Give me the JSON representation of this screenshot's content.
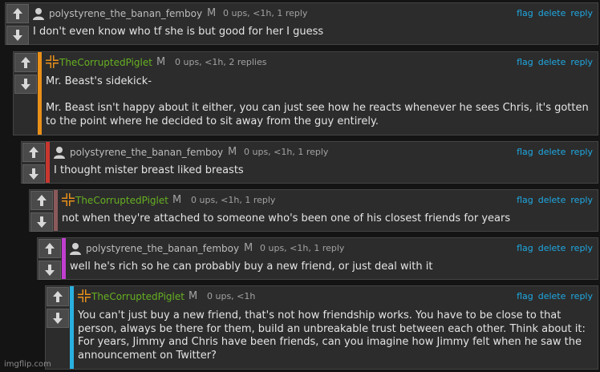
{
  "comments": [
    {
      "username": "polystyrene_the_banan_femboy",
      "mod_badge": "M",
      "meta": "0 ups, <1h, 1 reply",
      "actions": {
        "flag": "flag",
        "delete": "delete",
        "reply": "reply"
      },
      "body": "I don't even know who tf she is but good for her I guess",
      "accent_color": "none",
      "avatar": "user-silhouette-icon"
    },
    {
      "username": "TheCorruptedPiglet",
      "mod_badge": "M",
      "meta": "0 ups, <1h, 2 replies",
      "actions": {
        "flag": "flag",
        "delete": "delete",
        "reply": "reply"
      },
      "body": "Mr. Beast's sidekick-\n\nMr. Beast isn't happy about it either, you can just see how he reacts whenever he sees Chris, it's gotten to the point where he decided to sit away from the guy entirely.",
      "accent_color": "#e8901a",
      "avatar": "orange-cross-icon"
    },
    {
      "username": "polystyrene_the_banan_femboy",
      "mod_badge": "M",
      "meta": "0 ups, <1h, 1 reply",
      "actions": {
        "flag": "flag",
        "delete": "delete",
        "reply": "reply"
      },
      "body": "I thought mister breast liked breasts",
      "accent_color": "#c8372f",
      "avatar": "user-silhouette-icon"
    },
    {
      "username": "TheCorruptedPiglet",
      "mod_badge": "M",
      "meta": "0 ups, <1h, 1 reply",
      "actions": {
        "flag": "flag",
        "delete": "delete",
        "reply": "reply"
      },
      "body": "not when they're attached to someone who's been one of his closest friends for years",
      "accent_color": "#8a5a5a",
      "avatar": "orange-cross-icon"
    },
    {
      "username": "polystyrene_the_banan_femboy",
      "mod_badge": "M",
      "meta": "0 ups, <1h, 1 reply",
      "actions": {
        "flag": "flag",
        "delete": "delete",
        "reply": "reply"
      },
      "body": "well he's rich so he can probably buy a new friend, or just deal with it",
      "accent_color": "#c03fd0",
      "avatar": "user-silhouette-icon"
    },
    {
      "username": "TheCorruptedPiglet",
      "mod_badge": "M",
      "meta": "0 ups, <1h",
      "actions": {
        "flag": "flag",
        "delete": "delete",
        "reply": "reply"
      },
      "body": "You can't just buy a new friend, that's not how friendship works. You have to be close to that person, always be there for them, build an unbreakable trust between each other. Think about it: For years, Jimmy and Chris have been friends, can you imagine how Jimmy felt when he saw the announcement on Twitter?",
      "accent_color": "#2ab0e0",
      "avatar": "orange-cross-icon"
    }
  ],
  "watermark": "imgflip.com"
}
